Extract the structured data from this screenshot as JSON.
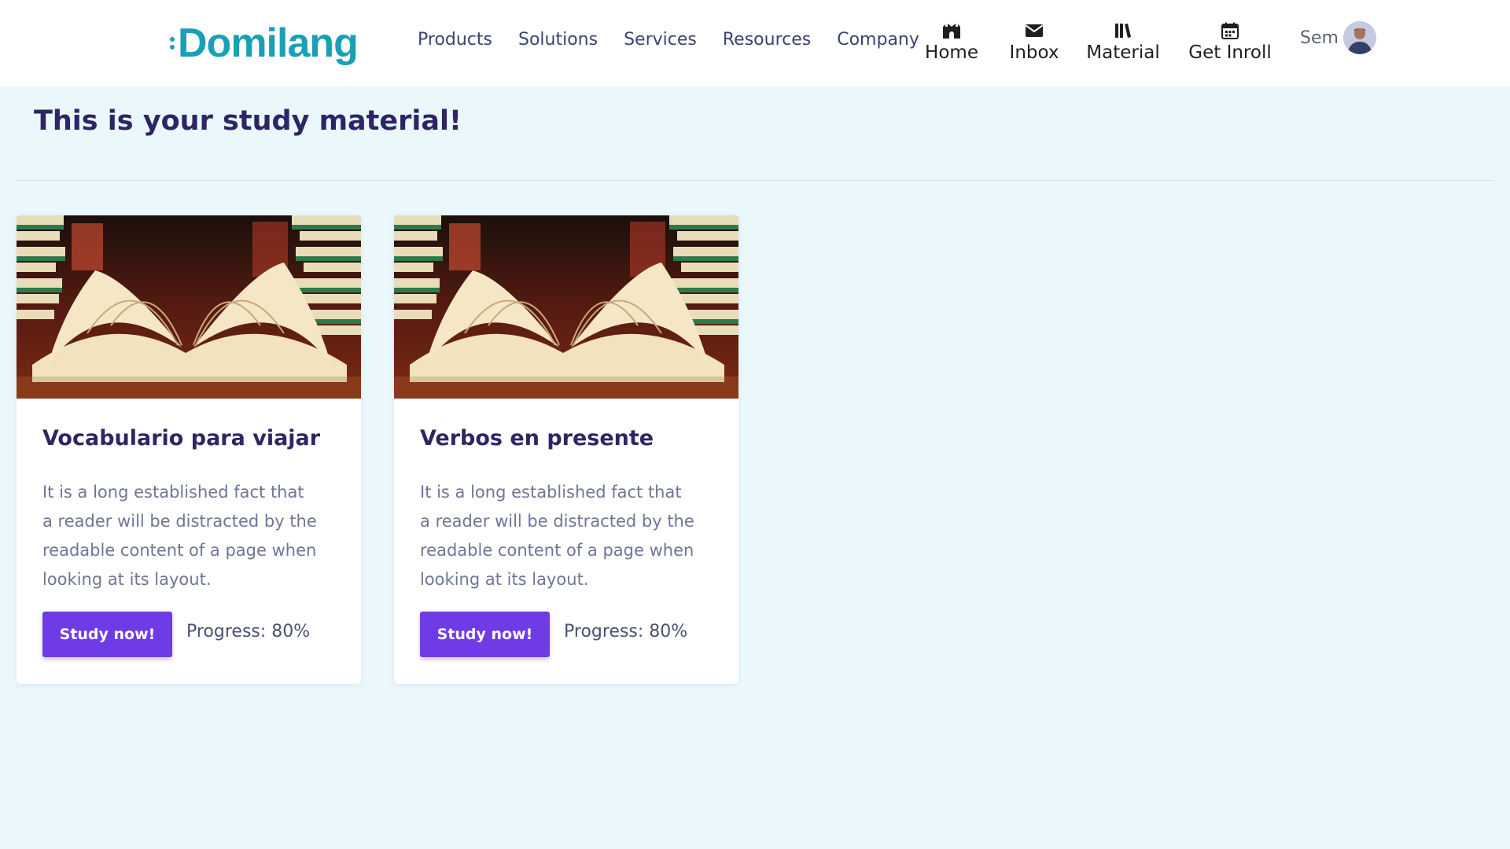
{
  "brand": {
    "name": "Domilang",
    "color": "#1aa0b5"
  },
  "nav": {
    "links": [
      "Products",
      "Solutions",
      "Services",
      "Resources",
      "Company"
    ],
    "icon_items": [
      {
        "label": "Home",
        "icon": "home-icon"
      },
      {
        "label": "Inbox",
        "icon": "envelope-icon"
      },
      {
        "label": "Material",
        "icon": "books-icon"
      },
      {
        "label": "Get Inroll",
        "icon": "calendar-icon"
      }
    ],
    "user": {
      "name": "Sem",
      "avatar": "avatar"
    }
  },
  "page": {
    "title": "This is your study material!"
  },
  "cards": [
    {
      "title": "Vocabulario para viajar",
      "description": "It is a long established fact that a reader will be distracted by the readable content of a page when looking at its layout.",
      "button": "Study now!",
      "progress_text": "Progress: 80%",
      "progress": 0.8
    },
    {
      "title": "Verbos en presente",
      "description": "It is a long established fact that a reader will be distracted by the readable content of a page when looking at its layout.",
      "button": "Study now!",
      "progress_text": "Progress: 80%",
      "progress": 0.8
    }
  ],
  "colors": {
    "accent": "#6f3be6",
    "background": "#eaf8fc",
    "heading": "#2f2466"
  }
}
